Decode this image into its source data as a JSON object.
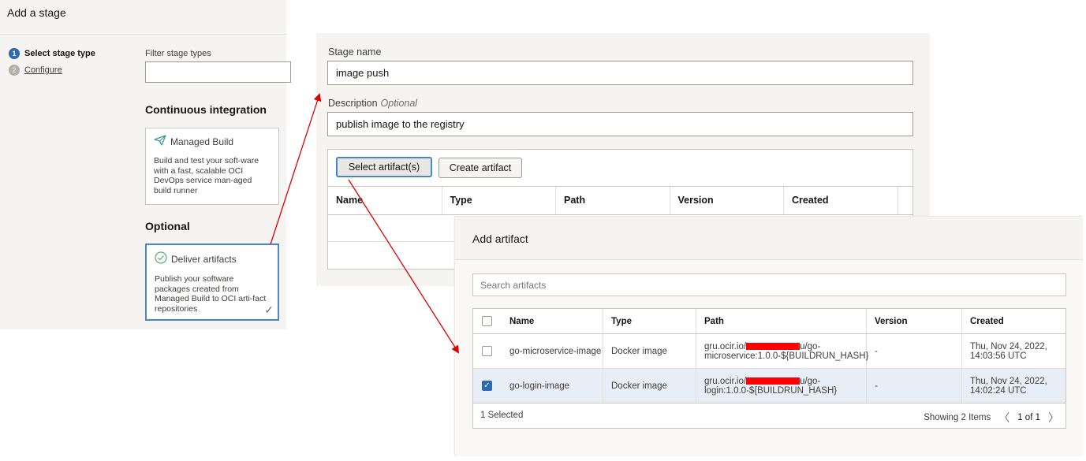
{
  "add_stage": {
    "title": "Add a stage",
    "steps": [
      {
        "number": "1",
        "label": "Select stage type"
      },
      {
        "number": "2",
        "label": "Configure"
      }
    ],
    "filter_label": "Filter stage types",
    "filter_value": "",
    "sections": {
      "ci": "Continuous integration",
      "optional": "Optional"
    },
    "cards": {
      "managed_build": {
        "icon": "paper-plane-icon",
        "title": "Managed Build",
        "desc": "Build and test your soft-ware with a fast, scalable OCI DevOps service man-aged build runner"
      },
      "deliver": {
        "icon": "check-circle-icon",
        "title": "Deliver artifacts",
        "desc": "Publish your software packages created from Managed Build to OCI arti-fact repositories",
        "selected_mark": "✓"
      }
    }
  },
  "stage_form": {
    "stage_name_label": "Stage name",
    "stage_name_value": "image push",
    "description_label": "Description",
    "description_optional": "Optional",
    "description_value": "publish image to the registry",
    "select_artifacts_btn": "Select artifact(s)",
    "create_artifact_btn": "Create artifact",
    "columns": [
      "Name",
      "Type",
      "Path",
      "Version",
      "Created"
    ]
  },
  "add_artifact": {
    "title": "Add artifact",
    "search_placeholder": "Search artifacts",
    "columns": [
      "Name",
      "Type",
      "Path",
      "Version",
      "Created"
    ],
    "rows": [
      {
        "checked": false,
        "name": "go-microservice-image",
        "type": "Docker image",
        "path_prefix": "gru.ocir.io/",
        "path_after_redact": "u/go-",
        "path_line2": "microservice:1.0.0-${BUILDRUN_HASH}",
        "version": "-",
        "created_line1": "Thu, Nov 24, 2022,",
        "created_line2": "14:03:56 UTC"
      },
      {
        "checked": true,
        "name": "go-login-image",
        "type": "Docker image",
        "path_prefix": "gru.ocir.io/",
        "path_after_redact": "u/go-",
        "path_line2": "login:1.0.0-${BUILDRUN_HASH}",
        "version": "-",
        "created_line1": "Thu, Nov 24, 2022,",
        "created_line2": "14:02:24 UTC"
      }
    ],
    "selected_text": "1 Selected",
    "showing_text": "Showing 2 Items",
    "page_text": "1 of 1"
  },
  "colors": {
    "annotation_arrow": "#e00000",
    "accent": "#2d6ab1",
    "redaction": "#ff0000"
  }
}
